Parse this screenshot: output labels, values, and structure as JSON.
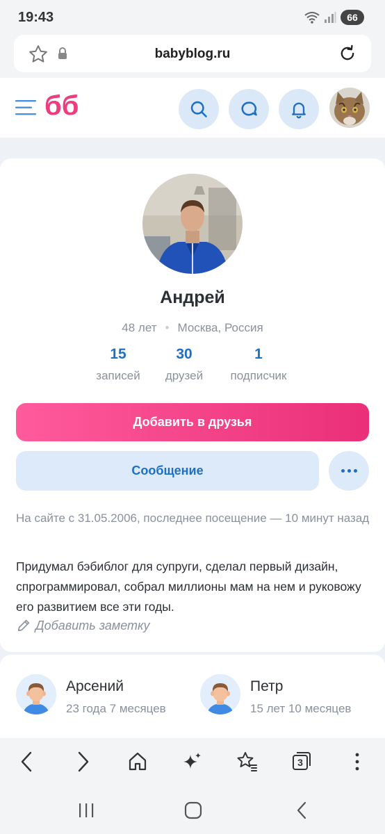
{
  "status": {
    "time": "19:43",
    "battery": "66"
  },
  "browser": {
    "url": "babyblog.ru",
    "tabs_count": "3"
  },
  "header": {
    "logo": "бб"
  },
  "profile": {
    "name": "Андрей",
    "age": "48 лет",
    "location": "Москва, Россия",
    "stats": [
      {
        "value": "15",
        "label": "записей"
      },
      {
        "value": "30",
        "label": "друзей"
      },
      {
        "value": "1",
        "label": "подписчик"
      }
    ],
    "add_friend_label": "Добавить в друзья",
    "message_label": "Сообщение",
    "onsite_text": "На сайте с 31.05.2006, последнее посещение — 10 минут назад",
    "bio": "Придумал бэбиблог для супруги, сделал первый дизайн, спрограммировал, собрал миллионы мам на нем и руковожу его развитием все эти годы.",
    "add_note_label": "Добавить заметку"
  },
  "children": [
    {
      "name": "Арсений",
      "age": "23 года 7 месяцев"
    },
    {
      "name": "Петр",
      "age": "15 лет 10 месяцев"
    }
  ],
  "colors": {
    "brand_pink": "#ec3e7e",
    "accent_blue": "#1f6fc5",
    "button_light_blue": "#ddeafa"
  }
}
